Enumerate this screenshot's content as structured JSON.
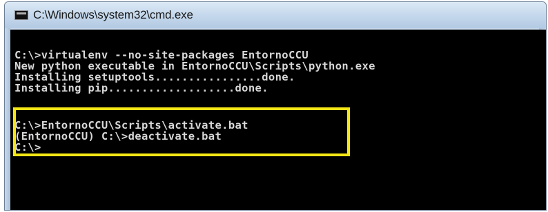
{
  "window": {
    "title": "C:\\Windows\\system32\\cmd.exe",
    "icon": "cmd-console-icon"
  },
  "console": {
    "lines": [
      "C:\\>virtualenv --no-site-packages EntornoCCU",
      "New python executable in EntornoCCU\\Scripts\\python.exe",
      "Installing setuptools................done.",
      "Installing pip...................done.",
      "",
      "C:\\>EntornoCCU\\Scripts\\activate.bat",
      "(EntornoCCU) C:\\>deactivate.bat",
      "C:\\>"
    ]
  },
  "colors": {
    "console_background": "#000000",
    "console_text": "#d8d8d8",
    "highlight_border": "#f5e616",
    "titlebar": "#c5d8ec"
  }
}
